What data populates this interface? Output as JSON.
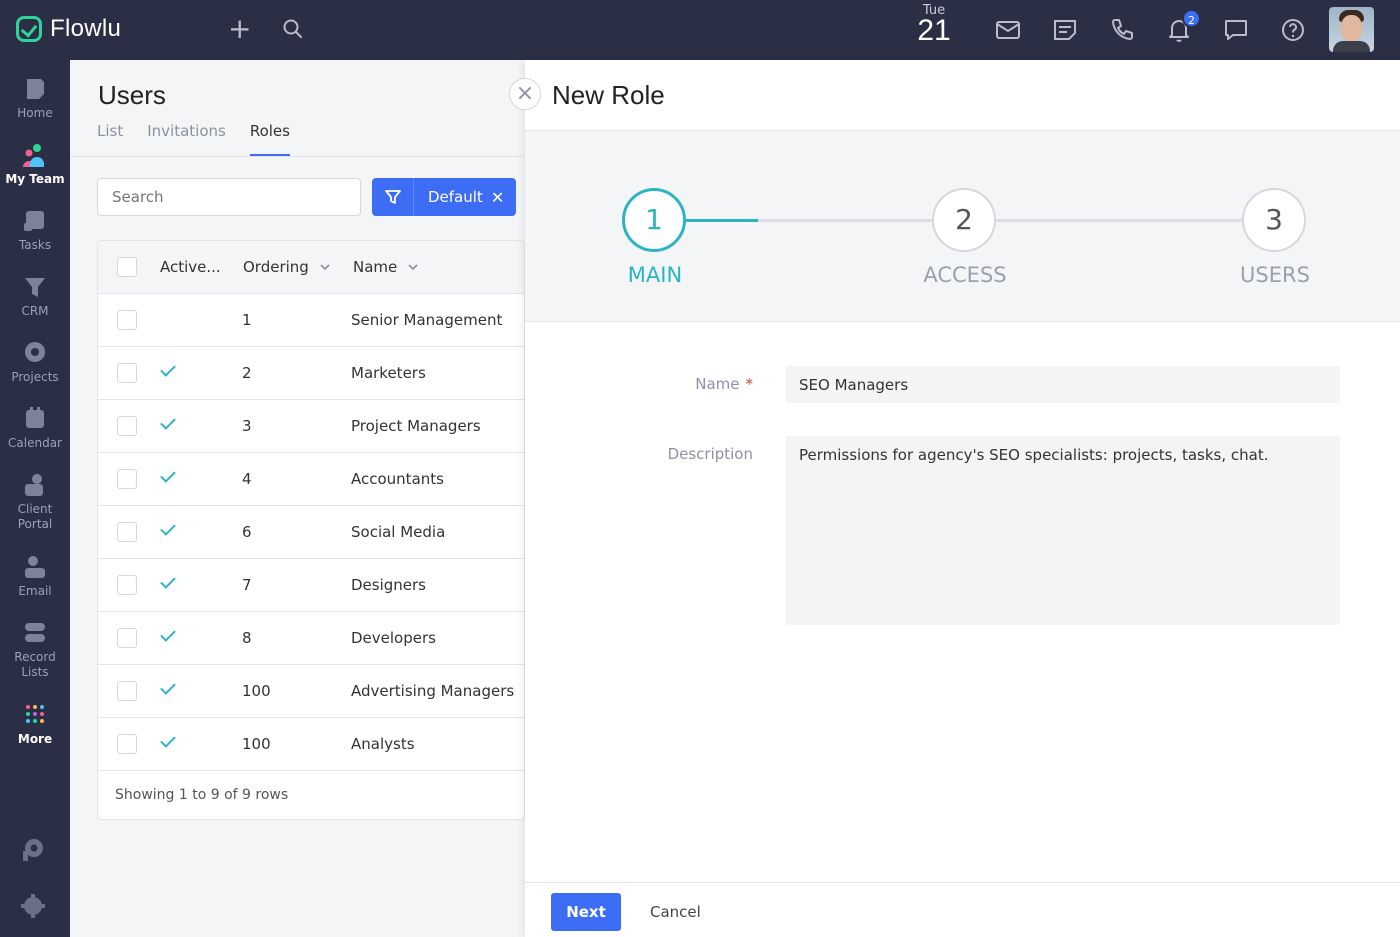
{
  "app": {
    "name": "Flowlu"
  },
  "topbar": {
    "date_day": "Tue",
    "date_num": "21",
    "notification_count": "2",
    "icons": [
      "plus-icon",
      "search-icon",
      "mail-icon",
      "notes-icon",
      "phone-icon",
      "bell-icon",
      "chat-icon",
      "help-icon"
    ]
  },
  "sidebar": {
    "items": [
      {
        "label": "Home",
        "icon": "home-icon"
      },
      {
        "label": "My Team",
        "icon": "team-icon"
      },
      {
        "label": "Tasks",
        "icon": "tasks-icon"
      },
      {
        "label": "CRM",
        "icon": "crm-icon"
      },
      {
        "label": "Projects",
        "icon": "projects-icon"
      },
      {
        "label": "Calendar",
        "icon": "calendar-icon"
      },
      {
        "label": "Client Portal",
        "icon": "client-portal-icon"
      },
      {
        "label": "Email",
        "icon": "email-icon"
      },
      {
        "label": "Record Lists",
        "icon": "record-lists-icon"
      },
      {
        "label": "More",
        "icon": "more-grid-icon"
      }
    ]
  },
  "users": {
    "title": "Users",
    "tabs": [
      "List",
      "Invitations",
      "Roles"
    ],
    "active_tab": "Roles",
    "search_placeholder": "Search",
    "filter_label": "Default",
    "columns": [
      "Active...",
      "Ordering",
      "Name"
    ],
    "rows": [
      {
        "active": false,
        "ordering": "1",
        "name": "Senior Management"
      },
      {
        "active": true,
        "ordering": "2",
        "name": "Marketers"
      },
      {
        "active": true,
        "ordering": "3",
        "name": "Project Managers"
      },
      {
        "active": true,
        "ordering": "4",
        "name": "Accountants"
      },
      {
        "active": true,
        "ordering": "6",
        "name": "Social Media"
      },
      {
        "active": true,
        "ordering": "7",
        "name": "Designers"
      },
      {
        "active": true,
        "ordering": "8",
        "name": "Developers"
      },
      {
        "active": true,
        "ordering": "100",
        "name": "Advertising Managers"
      },
      {
        "active": true,
        "ordering": "100",
        "name": "Analysts"
      }
    ],
    "footer": "Showing 1 to 9 of 9 rows"
  },
  "modal": {
    "title": "New Role",
    "steps": [
      {
        "num": "1",
        "label": "MAIN"
      },
      {
        "num": "2",
        "label": "ACCESS"
      },
      {
        "num": "3",
        "label": "USERS"
      }
    ],
    "name_label": "Name",
    "required_mark": "*",
    "name_value": "SEO Managers",
    "description_label": "Description",
    "description_value": "Permissions for agency's SEO specialists: projects, tasks, chat.",
    "next_label": "Next",
    "cancel_label": "Cancel"
  },
  "colors": {
    "topbar": "#2b2f45",
    "accent_blue": "#3d6cf5",
    "step_teal": "#2bb5c4",
    "logo_green": "#2fd49a"
  }
}
